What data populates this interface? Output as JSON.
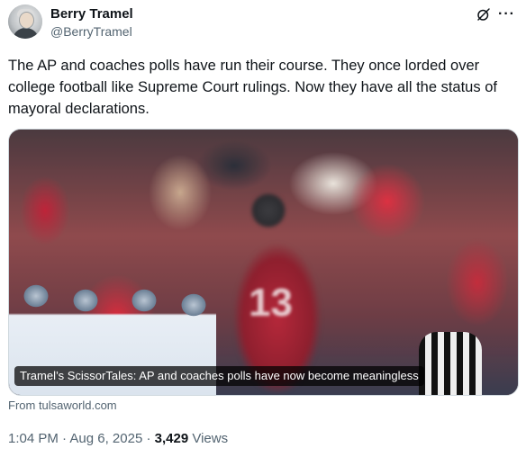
{
  "author": {
    "name": "Berry Tramel",
    "handle": "@BerryTramel"
  },
  "post": {
    "text": "The AP and coaches polls have run their course. They once lorded over college football like Supreme Court rulings. Now they have all the status of mayoral declarations."
  },
  "media": {
    "caption": "Tramel’s ScissorTales: AP and coaches polls have now become meaningless",
    "jersey_number": "13"
  },
  "link": {
    "source": "From tulsaworld.com"
  },
  "meta": {
    "time": "1:04 PM",
    "separator1": " · ",
    "date": "Aug 6, 2025",
    "separator2": " · ",
    "views_count": "3,429",
    "views_label": " Views"
  },
  "icons": {
    "grok": "grok-icon",
    "more": "more-icon"
  }
}
